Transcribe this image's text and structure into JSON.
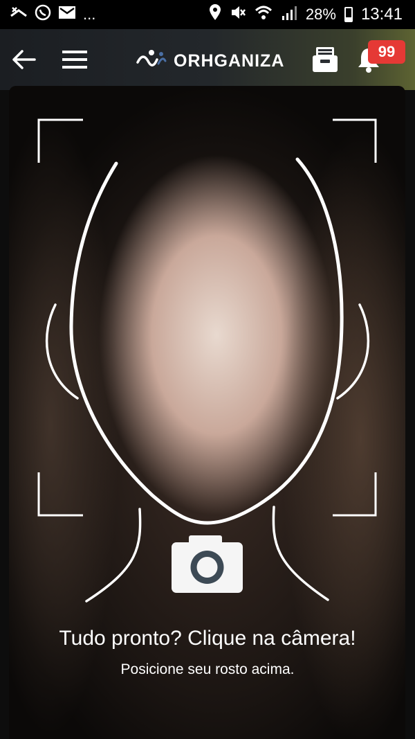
{
  "status_bar": {
    "battery": "28%",
    "time": "13:41",
    "overflow": "...",
    "icons": [
      "missed-call-icon",
      "whatsapp-icon",
      "mail-icon",
      "location-icon",
      "mute-icon",
      "wifi-icon",
      "signal-icon",
      "battery-icon"
    ]
  },
  "app_bar": {
    "brand_name": "ORHGANIZA",
    "notification_count": "99",
    "badge_color": "#e53935",
    "icons": [
      "back-arrow-icon",
      "menu-icon",
      "brand-logo-icon",
      "inbox-tray-icon",
      "bell-icon"
    ]
  },
  "camera": {
    "prompt": "Tudo pronto? Clique na câmera!",
    "hint": "Posicione seu rosto acima.",
    "capture_icon": "camera-icon"
  }
}
